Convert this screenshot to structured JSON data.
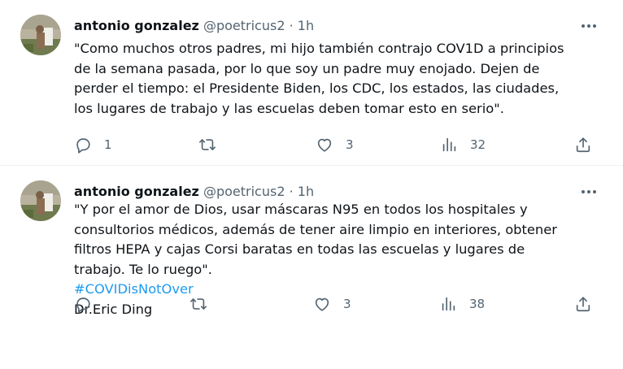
{
  "tweets": [
    {
      "author_name": "antonio gonzalez",
      "handle": "@poetricus2",
      "separator": "·",
      "time": "1h",
      "text_lines": [
        "\"Como muchos otros padres, mi hijo también contrajo COV1D a principios",
        "de la semana pasada, por lo que soy un padre muy enojado. Dejen de",
        "perder el tiempo: el Presidente Biden, los CDC, los estados, las ciudades,",
        "los lugares de trabajo y las escuelas deben tomar esto en serio\"."
      ],
      "replies": "1",
      "retweets": "",
      "likes": "3",
      "views": "32"
    },
    {
      "author_name": "antonio gonzalez",
      "handle": "@poetricus2",
      "separator": "·",
      "time": "1h",
      "text_lines": [
        "\"Y por el amor de Dios, usar máscaras N95 en todos los hospitales y",
        "consultorios médicos, además de tener aire limpio en interiores, obtener",
        "filtros HEPA y cajas Corsi baratas en todas las escuelas y lugares de",
        "trabajo. Te lo ruego\"."
      ],
      "hashtag": "#COVIDisNotOver",
      "signature": "Dr.Eric Ding",
      "replies": "",
      "retweets": "",
      "likes": "3",
      "views": "38"
    }
  ],
  "icons": {
    "more": "more-dots-icon",
    "reply": "reply-icon",
    "retweet": "retweet-icon",
    "like": "heart-icon",
    "views": "views-chart-icon",
    "share": "share-icon"
  },
  "colors": {
    "text": "#0f1419",
    "secondary": "#536471",
    "link": "#1d9bf0",
    "divider": "#eff3f4"
  }
}
